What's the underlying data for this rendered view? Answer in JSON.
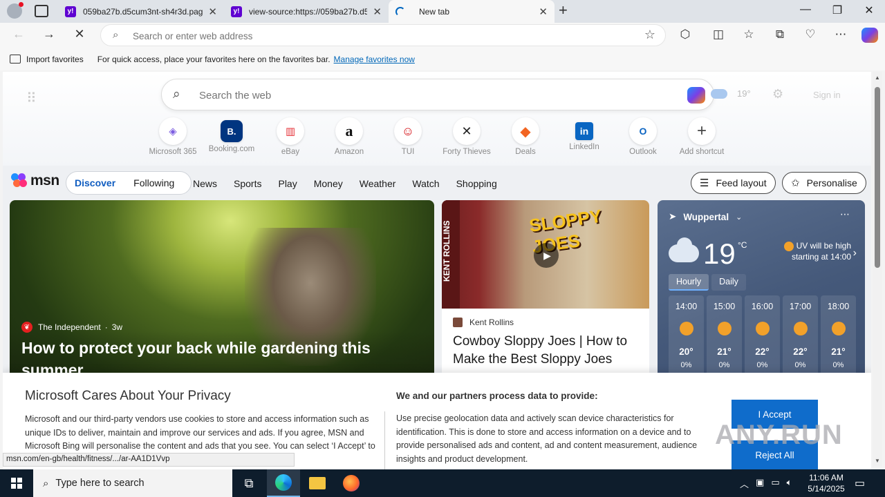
{
  "browser": {
    "tabs": [
      {
        "title": "059ba27b.d5cum3nt-sh4r3d.pag",
        "favicon": "yahoo-icon"
      },
      {
        "title": "view-source:https://059ba27b.d5",
        "favicon": "yahoo-icon"
      },
      {
        "title": "New tab",
        "favicon": "loading-spinner"
      }
    ],
    "address_placeholder": "Search or enter web address",
    "favorites_bar": {
      "import_label": "Import favorites",
      "message": "For quick access, place your favorites here on the favorites bar.",
      "manage_link": "Manage favorites now"
    }
  },
  "newtab": {
    "search_placeholder": "Search the web",
    "mini_weather": "19°",
    "signin_label": "Sign in",
    "shortcuts": [
      {
        "label": "Microsoft 365",
        "glyph": "◈",
        "color": "#7b5ce0"
      },
      {
        "label": "Booking.com",
        "glyph": "B.",
        "color": "#003580"
      },
      {
        "label": "eBay",
        "glyph": "▥",
        "color": "#e53238"
      },
      {
        "label": "Amazon",
        "glyph": "a",
        "color": "#111111"
      },
      {
        "label": "TUI",
        "glyph": "☺",
        "color": "#d40e14"
      },
      {
        "label": "Forty Thieves",
        "glyph": "✕",
        "color": "#222222"
      },
      {
        "label": "Deals",
        "glyph": "◆",
        "color": "#f26522"
      },
      {
        "label": "LinkedIn",
        "glyph": "in",
        "color": "#0a66c2"
      },
      {
        "label": "Outlook",
        "glyph": "O",
        "color": "#0a64c2"
      },
      {
        "label": "Add shortcut",
        "glyph": "+",
        "color": "#444444"
      }
    ]
  },
  "msn": {
    "logo_text": "msn",
    "feed_tabs": [
      "Discover",
      "Following"
    ],
    "nav": [
      "News",
      "Sports",
      "Play",
      "Money",
      "Weather",
      "Watch",
      "Shopping"
    ],
    "feed_layout_label": "Feed layout",
    "personalise_label": "Personalise"
  },
  "cards": {
    "main": {
      "source": "The Independent",
      "age": "3w",
      "title": "How to protect your back while gardening this summer"
    },
    "video": {
      "overlay_brand": "SLOPPY JOES",
      "side_text": "KENT ROLLINS",
      "source": "Kent Rollins",
      "title": "Cowboy Sloppy Joes | How to Make the Best Sloppy Joes"
    },
    "weather": {
      "location": "Wuppertal",
      "temp": "19",
      "unit": "°C",
      "uv_note": "UV will be high starting at 14:00",
      "tabs": [
        "Hourly",
        "Daily"
      ],
      "hours": [
        {
          "time": "14:00",
          "temp": "20°",
          "precip": "0%"
        },
        {
          "time": "15:00",
          "temp": "21°",
          "precip": "0%"
        },
        {
          "time": "16:00",
          "temp": "22°",
          "precip": "0%"
        },
        {
          "time": "17:00",
          "temp": "22°",
          "precip": "0%"
        },
        {
          "time": "18:00",
          "temp": "21°",
          "precip": "0%"
        }
      ]
    }
  },
  "privacy": {
    "title": "Microsoft Cares About Your Privacy",
    "body": "Microsoft and our third-party vendors use cookies to store and access information such as unique IDs to deliver, maintain and improve our services and ads. If you agree, MSN and Microsoft Bing will personalise the content and ads that you see. You can select ‘I Accept’ to consent to these uses or click on ‘Manage preferences’ to",
    "data_title": "We and our partners process data to provide:",
    "data_body": "Use precise geolocation data and actively scan device characteristics for identification. This is done to store and access information on a device and to provide personalised ads and content, ad and content measurement, audience insights and product development.",
    "accept_label": "I Accept",
    "reject_label": "Reject All"
  },
  "status_url": "msn.com/en-gb/health/fitness/.../ar-AA1D1Vvp",
  "watermark": "ANY.RUN",
  "taskbar": {
    "search_placeholder": "Type here to search",
    "time": "11:06 AM",
    "date": "5/14/2025"
  }
}
